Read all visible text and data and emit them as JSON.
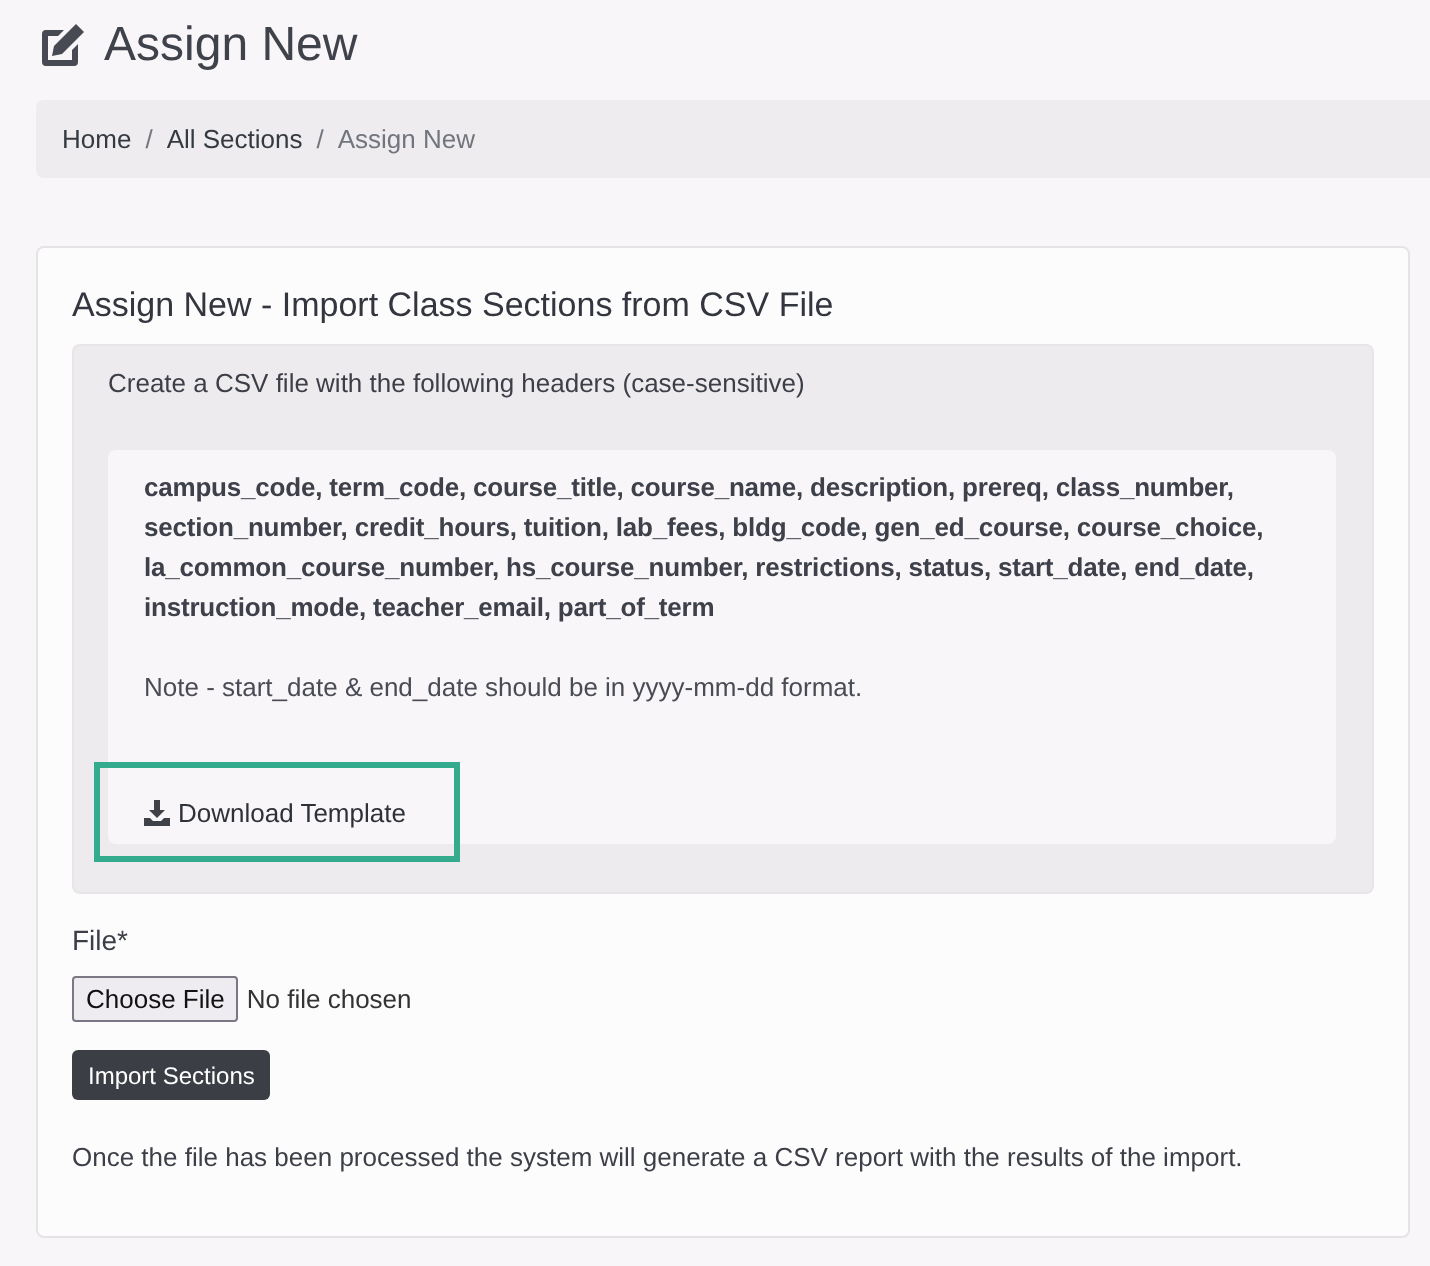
{
  "page": {
    "title": "Assign New"
  },
  "breadcrumb": {
    "separator": "/",
    "items": [
      {
        "label": "Home",
        "current": false
      },
      {
        "label": "All Sections",
        "current": false
      },
      {
        "label": "Assign New",
        "current": true
      }
    ]
  },
  "card": {
    "title": "Assign New - Import Class Sections from CSV File",
    "instructions": {
      "intro": "Create a CSV file with the following headers (case-sensitive)",
      "headers": "campus_code, term_code, course_title, course_name, description, prereq, class_number, section_number, credit_hours, tuition, lab_fees, bldg_code, gen_ed_course, course_choice, la_common_course_number, hs_course_number, restrictions, status, start_date, end_date, instruction_mode, teacher_email, part_of_term",
      "note": "Note - start_date & end_date should be in yyyy-mm-dd format.",
      "download_button": {
        "label": "Download Template",
        "highlighted": true
      }
    },
    "file_field": {
      "label": "File*",
      "button": "Choose File",
      "status": "No file chosen"
    },
    "import_button": "Import Sections",
    "footer_note": "Once the file has been processed the system will generate a CSV report with the results of the import."
  }
}
